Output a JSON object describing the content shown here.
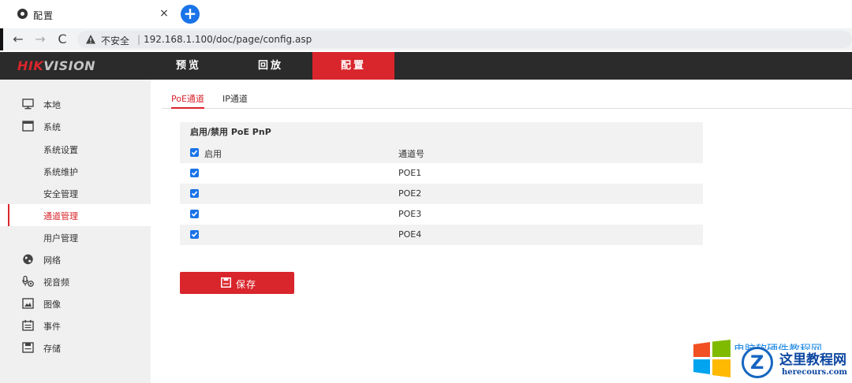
{
  "browser": {
    "tab_title": "配置",
    "close_glyph": "×",
    "new_tab_glyph": "+",
    "back_glyph": "←",
    "forward_glyph": "→",
    "reload_glyph": "C",
    "security_text": "不安全",
    "url": "192.168.1.100/doc/page/config.asp"
  },
  "header": {
    "logo_hik": "HIK",
    "logo_vision": "VISION",
    "nav": [
      {
        "label": "预览"
      },
      {
        "label": "回放"
      },
      {
        "label": "配置"
      }
    ],
    "active_nav": "配置"
  },
  "sidebar": {
    "items": [
      {
        "label": "本地",
        "icon": "monitor-icon"
      },
      {
        "label": "系统",
        "icon": "system-icon"
      },
      {
        "label": "系统设置"
      },
      {
        "label": "系统维护"
      },
      {
        "label": "安全管理"
      },
      {
        "label": "通道管理"
      },
      {
        "label": "用户管理"
      },
      {
        "label": "网络",
        "icon": "globe-icon"
      },
      {
        "label": "视音频",
        "icon": "audio-video-icon"
      },
      {
        "label": "图像",
        "icon": "image-icon"
      },
      {
        "label": "事件",
        "icon": "calendar-icon"
      },
      {
        "label": "存储",
        "icon": "storage-icon"
      }
    ],
    "active_item": "通道管理"
  },
  "content": {
    "tabs": [
      {
        "label": "PoE通道"
      },
      {
        "label": "IP通道"
      }
    ],
    "active_tab": "PoE通道",
    "panel_title": "启用/禁用 PoE PnP",
    "col_enable": "启用",
    "col_channel": "通道号",
    "rows": [
      {
        "channel": "POE1",
        "enabled": true
      },
      {
        "channel": "POE2",
        "enabled": true
      },
      {
        "channel": "POE3",
        "enabled": true
      },
      {
        "channel": "POE4",
        "enabled": true
      }
    ],
    "save_label": "保存"
  },
  "watermark": {
    "top_text": "电脑软硬件教程网",
    "z_letter": "Z",
    "name": "这里教程网",
    "url": "herecours.com"
  },
  "colors": {
    "accent_red": "#d9252c",
    "header_dark": "#2b2b2b",
    "checkbox_blue": "#1a73e8",
    "sidebar_bg": "#f0f0f0"
  }
}
